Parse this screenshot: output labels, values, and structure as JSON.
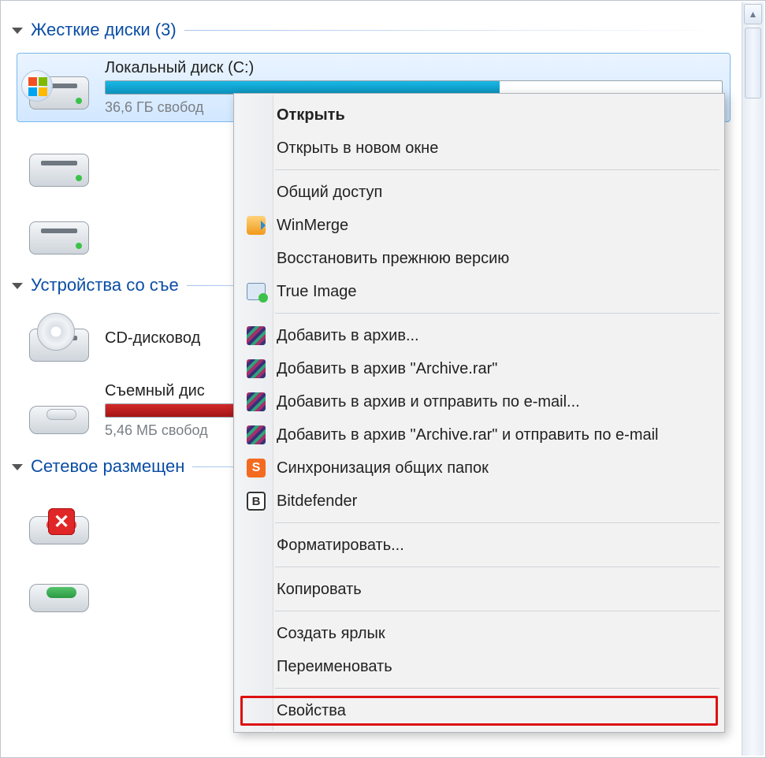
{
  "groups": {
    "hdd": {
      "title": "Жесткие диски (3)"
    },
    "removable": {
      "title": "Устройства со съе"
    },
    "network": {
      "title": "Сетевое размещен"
    }
  },
  "drives": {
    "c": {
      "name": "Локальный диск (C:)",
      "sub": "36,6 ГБ свобод",
      "fill_pct": 64,
      "fill_color": "#19b8e6"
    },
    "cd": {
      "name": "CD-дисковод"
    },
    "usb": {
      "name": "Съемный дис",
      "sub": "5,46 МБ свобод",
      "fill_pct": 96,
      "fill_color": "#d42a2a"
    }
  },
  "context_menu": [
    {
      "kind": "item",
      "label": "Открыть",
      "icon": "",
      "bold": true
    },
    {
      "kind": "item",
      "label": "Открыть в новом окне",
      "icon": ""
    },
    {
      "kind": "sep"
    },
    {
      "kind": "item",
      "label": "Общий доступ",
      "icon": ""
    },
    {
      "kind": "item",
      "label": "WinMerge",
      "icon": "winmerge"
    },
    {
      "kind": "item",
      "label": "Восстановить прежнюю версию",
      "icon": ""
    },
    {
      "kind": "item",
      "label": "True Image",
      "icon": "trueimage"
    },
    {
      "kind": "sep"
    },
    {
      "kind": "item",
      "label": "Добавить в архив...",
      "icon": "rar"
    },
    {
      "kind": "item",
      "label": "Добавить в архив \"Archive.rar\"",
      "icon": "rar"
    },
    {
      "kind": "item",
      "label": "Добавить в архив и отправить по e-mail...",
      "icon": "rar"
    },
    {
      "kind": "item",
      "label": "Добавить в архив \"Archive.rar\" и отправить по e-mail",
      "icon": "rar"
    },
    {
      "kind": "item",
      "label": "Синхронизация общих папок",
      "icon": "sync"
    },
    {
      "kind": "item",
      "label": "Bitdefender",
      "icon": "bd"
    },
    {
      "kind": "sep"
    },
    {
      "kind": "item",
      "label": "Форматировать...",
      "icon": ""
    },
    {
      "kind": "sep"
    },
    {
      "kind": "item",
      "label": "Копировать",
      "icon": ""
    },
    {
      "kind": "sep"
    },
    {
      "kind": "item",
      "label": "Создать ярлык",
      "icon": ""
    },
    {
      "kind": "item",
      "label": "Переименовать",
      "icon": ""
    },
    {
      "kind": "sep"
    },
    {
      "kind": "item",
      "label": "Свойства",
      "icon": "",
      "highlight": true
    }
  ]
}
